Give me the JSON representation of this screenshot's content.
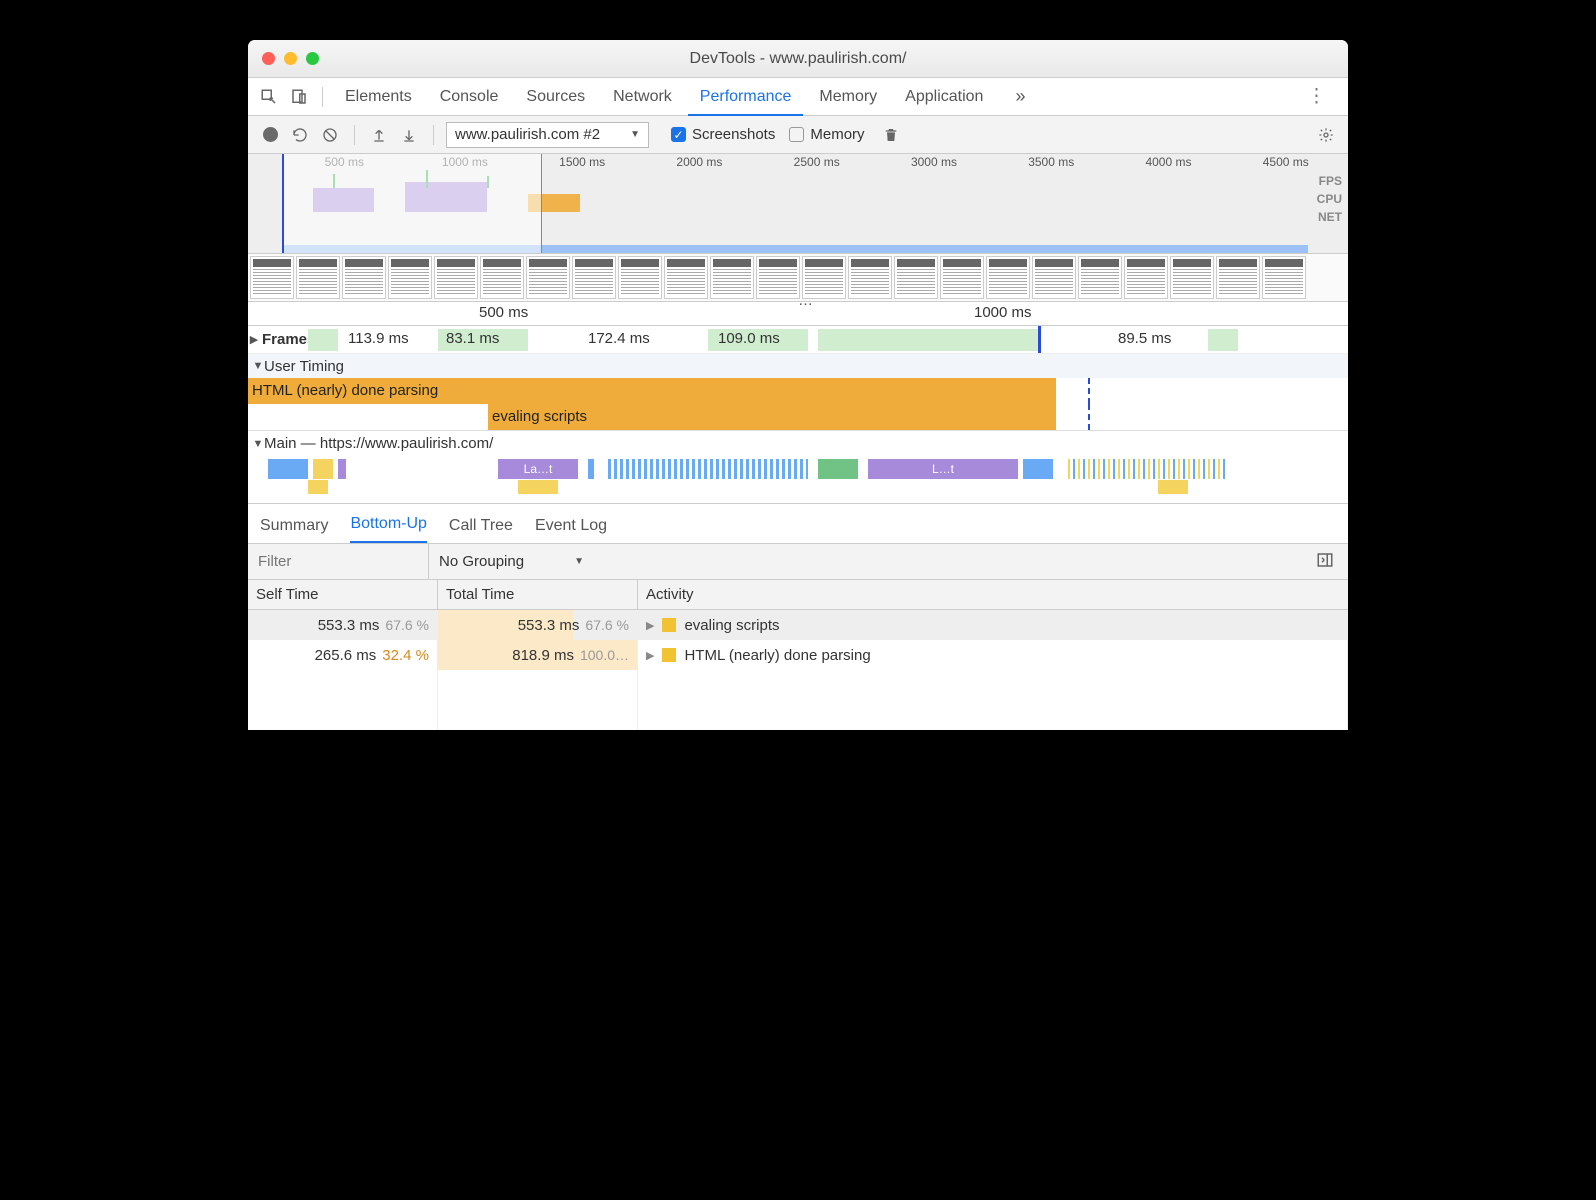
{
  "window": {
    "title": "DevTools - www.paulirish.com/"
  },
  "panelTabs": [
    "Elements",
    "Console",
    "Sources",
    "Network",
    "Performance",
    "Memory",
    "Application"
  ],
  "panelActive": "Performance",
  "overflowGlyph": "»",
  "toolbar": {
    "recording": "www.paulirish.com #2",
    "screenshots_label": "Screenshots",
    "memory_label": "Memory",
    "screenshots_checked": true,
    "memory_checked": false
  },
  "overview": {
    "ticks": [
      "500 ms",
      "1000 ms",
      "1500 ms",
      "2000 ms",
      "2500 ms",
      "3000 ms",
      "3500 ms",
      "4000 ms",
      "4500 ms"
    ],
    "labels": [
      "FPS",
      "CPU",
      "NET"
    ]
  },
  "timelineTicks": [
    "500 ms",
    "1000 ms"
  ],
  "frames": {
    "label": "Frames",
    "items": [
      "113.9 ms",
      "83.1 ms",
      "172.4 ms",
      "109.0 ms",
      "89.5 ms"
    ]
  },
  "userTiming": {
    "label": "User Timing",
    "bar1": "HTML (nearly) done parsing",
    "bar2": "evaling scripts"
  },
  "mainThread": {
    "label": "Main — https://www.paulirish.com/",
    "snip1": "La…t",
    "snip2": "L…t"
  },
  "detailTabs": [
    "Summary",
    "Bottom-Up",
    "Call Tree",
    "Event Log"
  ],
  "detailActive": "Bottom-Up",
  "filter": {
    "placeholder": "Filter",
    "grouping": "No Grouping"
  },
  "columns": [
    "Self Time",
    "Total Time",
    "Activity"
  ],
  "rows": [
    {
      "self_ms": "553.3 ms",
      "self_pct": "67.6 %",
      "total_ms": "553.3 ms",
      "total_pct": "67.6 %",
      "total_bar": 67.6,
      "activity": "evaling scripts",
      "selected": true
    },
    {
      "self_ms": "265.6 ms",
      "self_pct": "32.4 %",
      "total_ms": "818.9 ms",
      "total_pct": "100.0…",
      "total_bar": 100,
      "activity": "HTML (nearly) done parsing",
      "selected": false,
      "self_pct_orange": true
    }
  ]
}
